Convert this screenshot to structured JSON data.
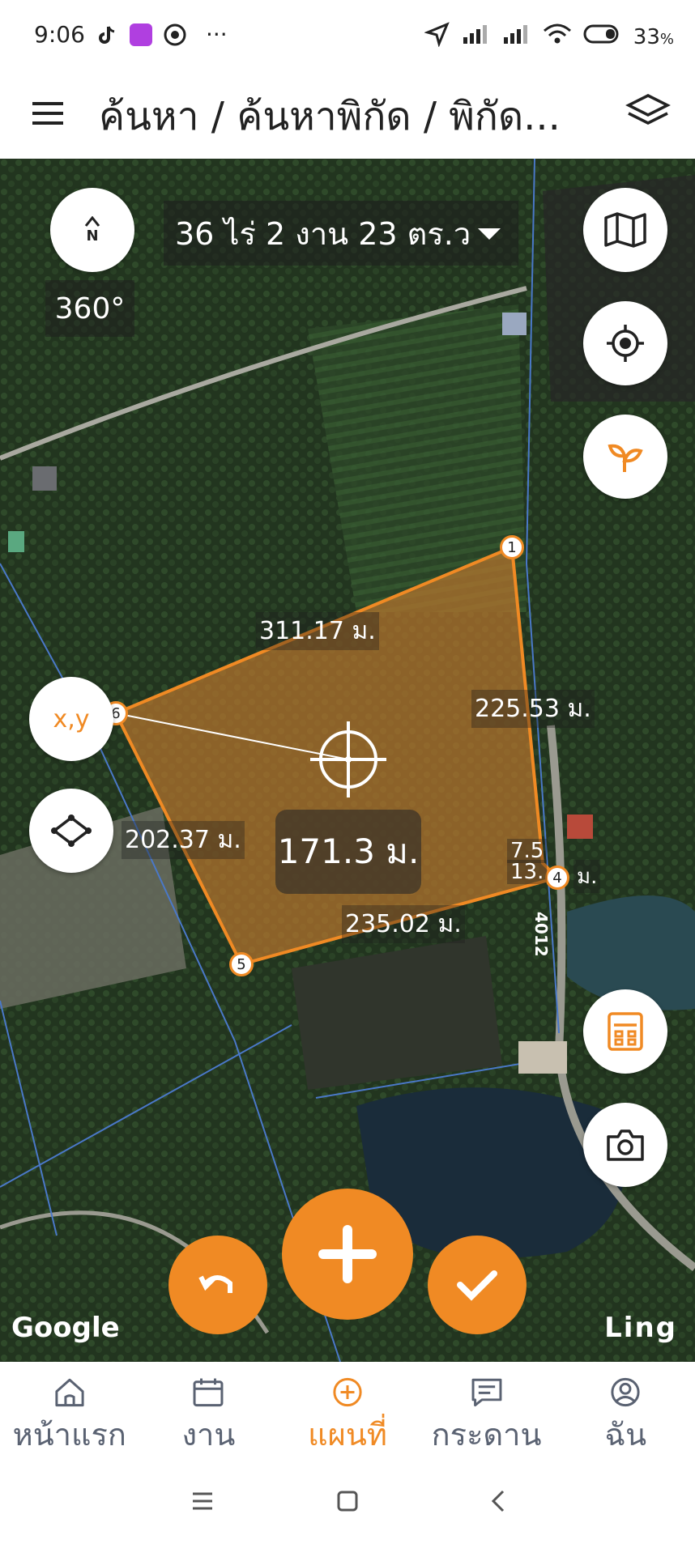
{
  "status": {
    "time": "9:06",
    "battery": "33",
    "battery_unit": "%",
    "dots": "···"
  },
  "appbar": {
    "title": "ค้นหา / ค้นหาพิกัด / พิกัด..."
  },
  "map": {
    "area_text": "36 ไร่ 2 งาน 23 ตร.ว",
    "rotation": "360°",
    "compass_letter": "N",
    "xy_label": "x,y",
    "center_distance": "171.3 ม.",
    "distances": {
      "d12": "311.17 ม.",
      "d23": "225.53 ม.",
      "d56": "202.37 ม.",
      "d45": "235.02 ม.",
      "d34a": "7.5",
      "d34b": "13.",
      "d34c": "ม."
    },
    "vertex_labels": [
      "1",
      "4",
      "5",
      "6"
    ],
    "road_label": "4012",
    "google_label": "Google",
    "ling_label": "Ling"
  },
  "bottom_nav": [
    {
      "label": "หน้าแรก",
      "icon": "home-icon"
    },
    {
      "label": "งาน",
      "icon": "calendar-icon"
    },
    {
      "label": "แผนที่",
      "icon": "add-circle-icon"
    },
    {
      "label": "กระดาน",
      "icon": "board-icon"
    },
    {
      "label": "ฉัน",
      "icon": "profile-icon"
    }
  ],
  "colors": {
    "accent": "#f08a24",
    "nav_inactive": "#5a6272",
    "plot_fill": "#b5742e"
  }
}
